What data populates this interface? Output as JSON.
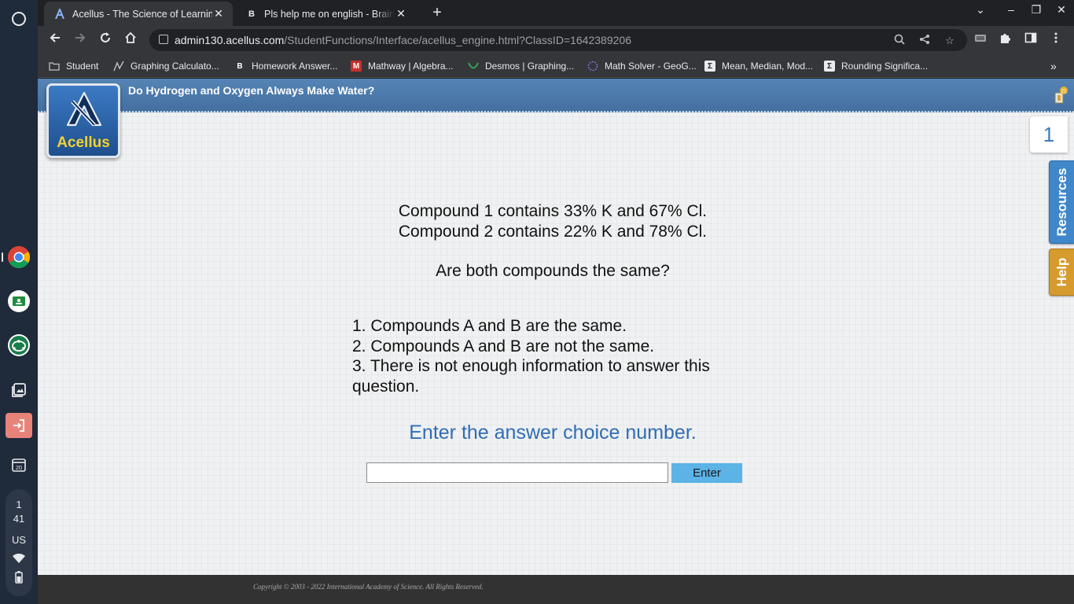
{
  "tabs": [
    {
      "title": "Acellus - The Science of Learning",
      "active": true
    },
    {
      "title": "Pls help me on english - Brainly.c",
      "active": false
    }
  ],
  "address_bar": {
    "domain": "admin130.acellus.com",
    "path": "/StudentFunctions/Interface/acellus_engine.html?ClassID=1642389206"
  },
  "bookmarks": [
    {
      "label": "Student",
      "icon": "folder-icon"
    },
    {
      "label": "Graphing Calculato...",
      "icon": "graph-icon"
    },
    {
      "label": "Homework Answer...",
      "icon": "brainly-icon"
    },
    {
      "label": "Mathway | Algebra...",
      "icon": "mathway-icon"
    },
    {
      "label": "Desmos | Graphing...",
      "icon": "desmos-icon"
    },
    {
      "label": "Math Solver - GeoG...",
      "icon": "geogebra-icon"
    },
    {
      "label": "Mean, Median, Mod...",
      "icon": "sigma-icon"
    },
    {
      "label": "Rounding Significa...",
      "icon": "sigma-icon"
    }
  ],
  "shelf": {
    "status": {
      "time_hour": "1",
      "time_minute": "41",
      "locale": "US"
    },
    "calendar_day": "20"
  },
  "lesson": {
    "title": "Do Hydrogen and Oxygen Always Make Water?",
    "logo_text": "Acellus",
    "counter": "1",
    "badge": "21"
  },
  "side_tabs": {
    "resources": "Resources",
    "help": "Help"
  },
  "question": {
    "line1": "Compound 1 contains 33% K and 67% Cl.",
    "line2": "Compound 2 contains 22% K and 78% Cl.",
    "line3": "Are both compounds the same?"
  },
  "choices": [
    "1. Compounds A and B are the same.",
    "2. Compounds A and B are not the same.",
    "3. There is not enough information to answer this question."
  ],
  "prompt": "Enter the answer choice number.",
  "answer": {
    "value": "",
    "button_label": "Enter"
  },
  "footer": {
    "copyright": "Copyright © 2003 - 2022 International Academy of Science.  All Rights Reserved."
  },
  "colors": {
    "banner": "#4d79a8",
    "prompt": "#2f6db5",
    "enter_button": "#5cb3e6",
    "resources_tab": "#3f87c9",
    "help_tab": "#d69a2d"
  }
}
